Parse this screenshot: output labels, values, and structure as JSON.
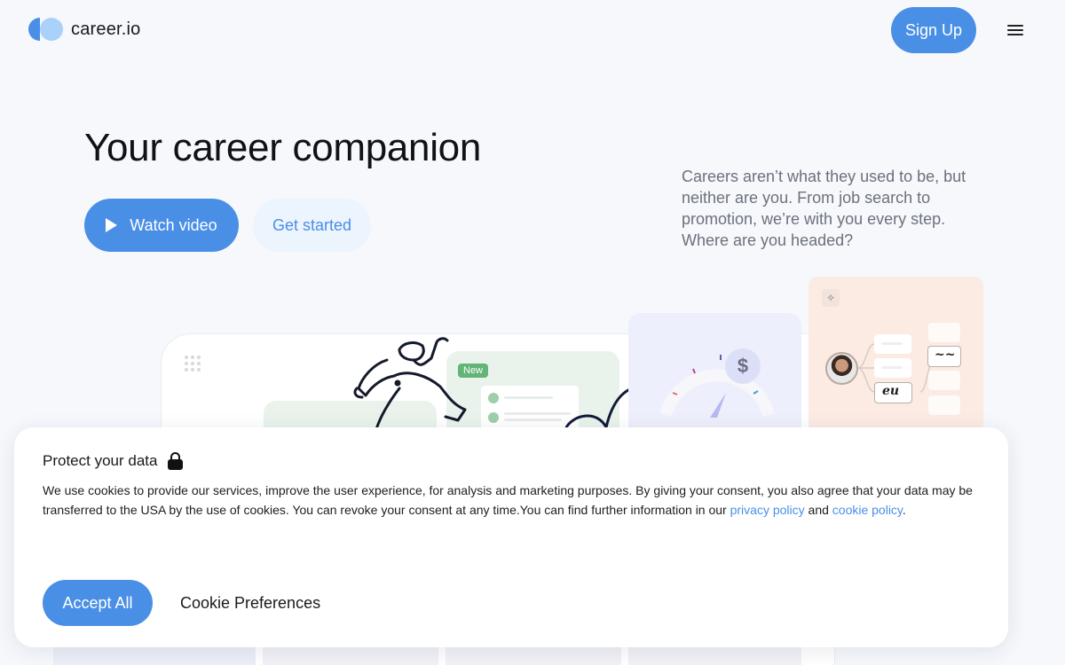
{
  "header": {
    "logo_text": "career.io",
    "signup_label": "Sign Up",
    "menu_icon": "hamburger-menu-icon"
  },
  "hero": {
    "title": "Your career companion",
    "watch_video_label": "Watch video",
    "get_started_label": "Get started",
    "description": "Careers aren’t what they used to be, but neither are you. From job search to promotion, we’re with you every step. Where are you headed?"
  },
  "illustration": {
    "badge_new": "New",
    "currency_symbol": "$"
  },
  "cookie": {
    "title": "Protect your data",
    "body_1": "We use cookies to provide our services, improve the user experience, for analysis and marketing purposes. By giving your consent, you also agree that your data may be transferred to the USA by the use of cookies. You can revoke your consent at any time.You can find further information in our ",
    "privacy_link": "privacy policy",
    "and_text": " and ",
    "cookie_link": "cookie policy",
    "end_text": ".",
    "accept_label": "Accept All",
    "preferences_label": "Cookie Preferences"
  },
  "colors": {
    "primary": "#4a8fe6",
    "secondary_bg": "#ecf4fe",
    "page_bg": "#f6f8fc",
    "badge_green": "#63b478"
  }
}
